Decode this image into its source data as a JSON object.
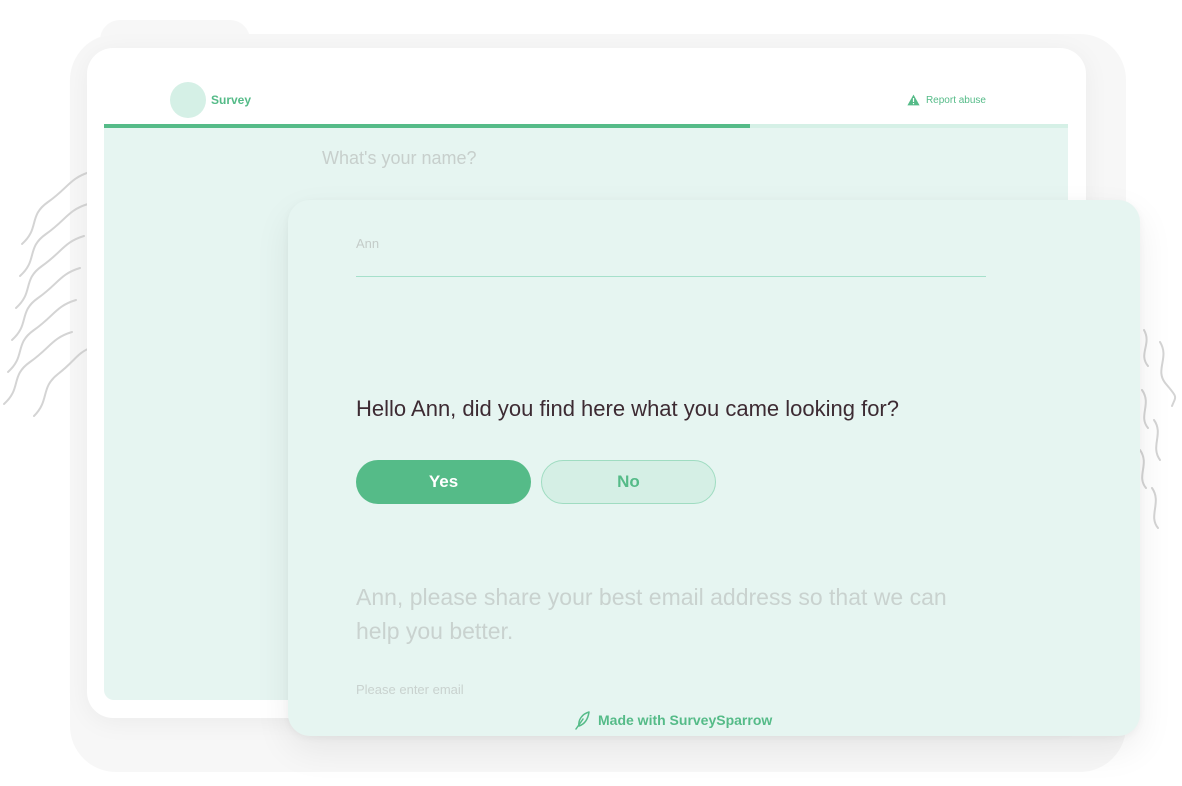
{
  "header": {
    "brand_name": "Survey",
    "report_label": "Report abuse"
  },
  "progress": {
    "fraction": 0.67
  },
  "previous_question": {
    "text": "What's your name?",
    "answer": "Ann"
  },
  "current_question": {
    "text": "Hello Ann, did you find here what you came looking for?",
    "options": [
      "Yes",
      "No"
    ],
    "selected": "Yes"
  },
  "next_question": {
    "text": "Ann, please share your best email address so that we can help you better.",
    "placeholder": "Please enter email"
  },
  "footer": {
    "made_with": "Made with SurveySparrow"
  },
  "colors": {
    "accent": "#55bb88",
    "accent_light": "#d5f0e6",
    "card_bg": "#e6f5f1",
    "question_text": "#3d2b33",
    "faded_text": "#c9d2cf"
  },
  "icons": {
    "report": "warning-triangle-icon",
    "footer": "feather-icon"
  }
}
